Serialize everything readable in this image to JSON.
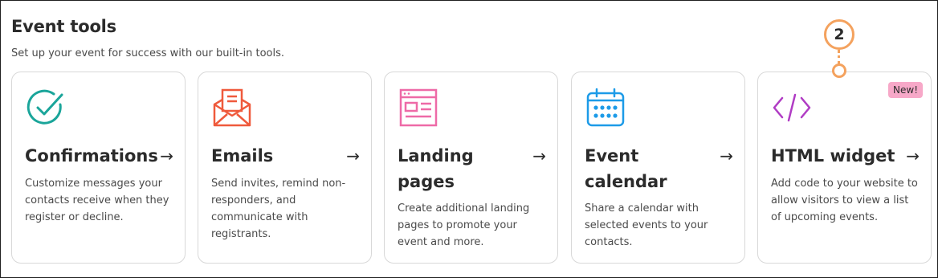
{
  "section": {
    "title": "Event tools",
    "subtitle": "Set up your event for success with our built-in tools."
  },
  "cards": [
    {
      "title": "Confirmations",
      "icon": "check-circle-icon",
      "arrow": "→",
      "description": "Customize messages your contacts receive when they register or decline."
    },
    {
      "title": "Emails",
      "icon": "envelope-icon",
      "arrow": "→",
      "description": "Send invites, remind non-responders, and communicate with registrants."
    },
    {
      "title": "Landing pages",
      "icon": "webpage-icon",
      "arrow": "→",
      "description": "Create additional landing pages to promote your event and more."
    },
    {
      "title": "Event calendar",
      "icon": "calendar-icon",
      "arrow": "→",
      "description": "Share a calendar with selected events to your contacts."
    },
    {
      "title": "HTML widget",
      "icon": "code-icon",
      "arrow": "→",
      "badge": "New!",
      "description": "Add code to your website to allow visitors to view a list of upcoming events."
    }
  ],
  "callout": {
    "number": "2"
  },
  "colors": {
    "teal": "#1aa59a",
    "coral": "#ef5a3c",
    "pink": "#ee6aa7",
    "blue": "#1d9be8",
    "purple": "#b03cc4",
    "callout": "#f4a25e",
    "badge": "#f7a8c8"
  }
}
